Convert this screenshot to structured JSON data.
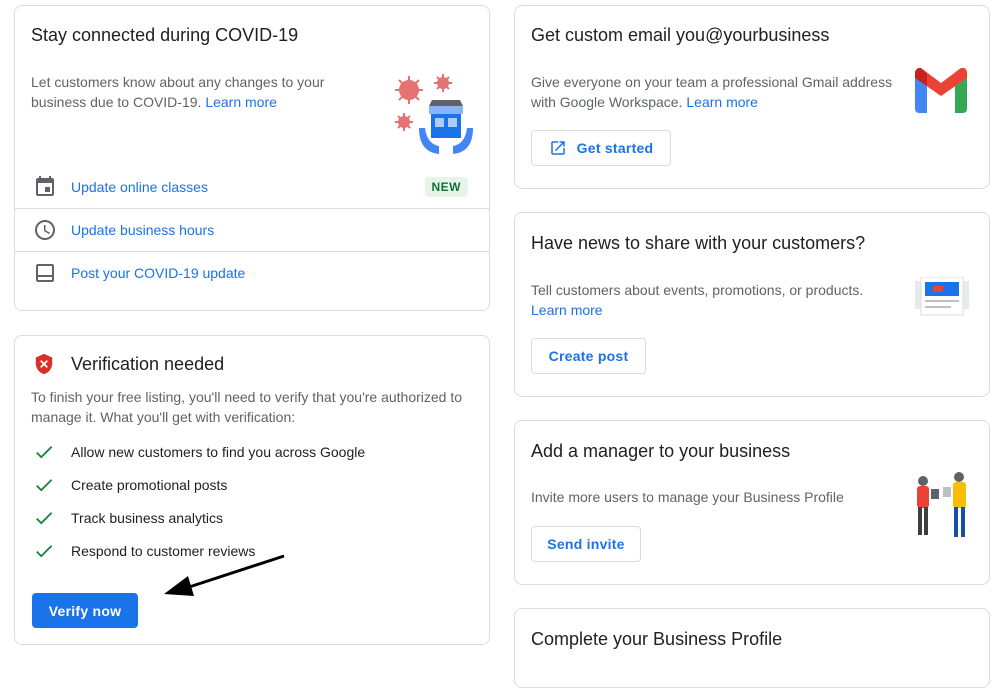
{
  "covid_card": {
    "title": "Stay connected during COVID-19",
    "desc": "Let customers know about any changes to your business due to COVID-19.",
    "learn_more": "Learn more",
    "actions": [
      {
        "label": "Update online classes",
        "icon": "calendar-icon",
        "badge": "NEW"
      },
      {
        "label": "Update business hours",
        "icon": "clock-icon"
      },
      {
        "label": "Post your COVID-19 update",
        "icon": "post-icon"
      }
    ]
  },
  "verification_card": {
    "title": "Verification needed",
    "desc": "To finish your free listing, you'll need to verify that you're authorized to manage it. What you'll get with verification:",
    "benefits": [
      "Allow new customers to find you across Google",
      "Create promotional posts",
      "Track business analytics",
      "Respond to customer reviews"
    ],
    "button": "Verify now"
  },
  "email_card": {
    "title": "Get custom email you@yourbusiness",
    "desc": "Give everyone on your team a professional Gmail address with Google Workspace.",
    "learn_more": "Learn more",
    "button": "Get started"
  },
  "news_card": {
    "title": "Have news to share with your customers?",
    "desc": "Tell customers about events, promotions, or products.",
    "learn_more": "Learn more",
    "button": "Create post"
  },
  "manager_card": {
    "title": "Add a manager to your business",
    "desc": "Invite more users to manage your Business Profile",
    "button": "Send invite"
  },
  "profile_card": {
    "title": "Complete your Business Profile"
  },
  "colors": {
    "link": "#1a73e8",
    "primary_button": "#1a73e8",
    "check": "#188038",
    "badge_bg": "#e6f4ea",
    "badge_text": "#137333",
    "warning": "#d93025"
  }
}
